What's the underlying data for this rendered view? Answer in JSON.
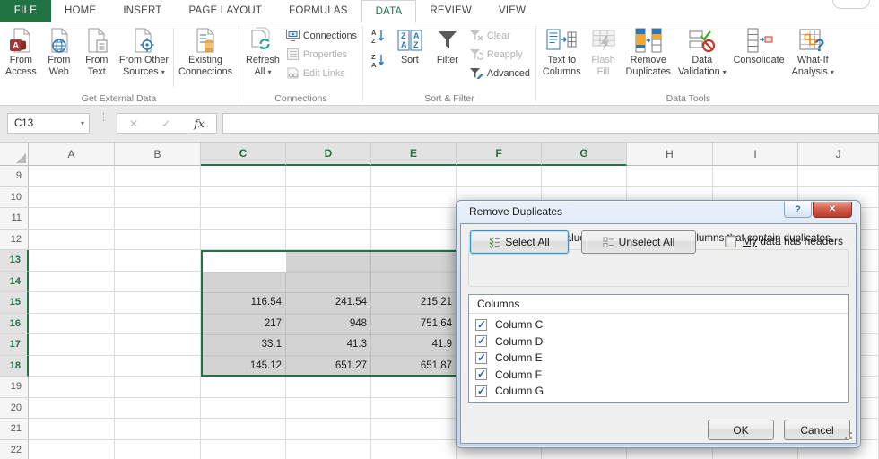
{
  "tabs": {
    "file": "FILE",
    "items": [
      "HOME",
      "INSERT",
      "PAGE LAYOUT",
      "FORMULAS",
      "DATA",
      "REVIEW",
      "VIEW"
    ],
    "active": "DATA"
  },
  "ribbon": {
    "get_external_data": {
      "label": "Get External Data",
      "from_access": {
        "l1": "From",
        "l2": "Access"
      },
      "from_web": {
        "l1": "From",
        "l2": "Web"
      },
      "from_text": {
        "l1": "From",
        "l2": "Text"
      },
      "from_other_sources": {
        "l1": "From Other",
        "l2": "Sources",
        "arrow": "▾"
      },
      "existing_connections": {
        "l1": "Existing",
        "l2": "Connections"
      }
    },
    "connections": {
      "label": "Connections",
      "refresh_all": {
        "l1": "Refresh",
        "l2": "All",
        "arrow": "▾"
      },
      "connections_btn": "Connections",
      "properties": "Properties",
      "edit_links": "Edit Links"
    },
    "sort_filter": {
      "label": "Sort & Filter",
      "az_top": "A",
      "az_bottom": "Z",
      "za_top": "Z",
      "za_bottom": "A",
      "sort_arrow": "↓",
      "sort": "Sort",
      "filter": "Filter",
      "clear": "Clear",
      "reapply": "Reapply",
      "advanced": "Advanced"
    },
    "data_tools": {
      "label": "Data Tools",
      "text_to_columns": {
        "l1": "Text to",
        "l2": "Columns"
      },
      "flash_fill": {
        "l1": "Flash",
        "l2": "Fill"
      },
      "remove_duplicates": {
        "l1": "Remove",
        "l2": "Duplicates"
      },
      "data_validation": {
        "l1": "Data",
        "l2": "Validation",
        "arrow": "▾"
      },
      "consolidate": {
        "l1": "Consolidate",
        "l2": ""
      },
      "what_if": {
        "l1": "What-If",
        "l2": "Analysis",
        "arrow": "▾"
      }
    }
  },
  "formula_bar": {
    "name_box": "C13",
    "name_box_arrow": "▾",
    "cancel_glyph": "✕",
    "enter_glyph": "✓",
    "fx_label": "fx",
    "value": ""
  },
  "grid": {
    "col_headers": [
      "A",
      "B",
      "C",
      "D",
      "E",
      "F",
      "G",
      "H",
      "I",
      "J"
    ],
    "row_headers": [
      "9",
      "10",
      "11",
      "12",
      "13",
      "14",
      "15",
      "16",
      "17",
      "18",
      "19",
      "20",
      "21",
      "22"
    ],
    "selected_cols": [
      "C",
      "D",
      "E",
      "F",
      "G"
    ],
    "selected_rows": [
      "13",
      "14",
      "15",
      "16",
      "17",
      "18"
    ],
    "active_cell": "C13",
    "values": [
      [
        "116.54",
        "241.54",
        "215.21"
      ],
      [
        "217",
        "948",
        "751.64"
      ],
      [
        "33.1",
        "41.3",
        "41.9"
      ],
      [
        "145.12",
        "651.27",
        "651.87"
      ]
    ]
  },
  "dialog": {
    "title": "Remove Duplicates",
    "help_glyph": "?",
    "close_glyph": "✕",
    "instruction": "To delete duplicate values, select one or more columns that contain duplicates.",
    "select_all": {
      "pre": "Select ",
      "key": "A",
      "post": "ll"
    },
    "unselect_all": {
      "pre": "",
      "key": "U",
      "post": "nselect All"
    },
    "headers_checkbox": {
      "key": "My",
      "post": " data has headers",
      "checked": false
    },
    "columns_header": "Columns",
    "items": [
      {
        "label": "Column C",
        "checked": true
      },
      {
        "label": "Column D",
        "checked": true
      },
      {
        "label": "Column E",
        "checked": true
      },
      {
        "label": "Column F",
        "checked": true
      },
      {
        "label": "Column G",
        "checked": true
      }
    ],
    "ok": "OK",
    "cancel": "Cancel"
  }
}
